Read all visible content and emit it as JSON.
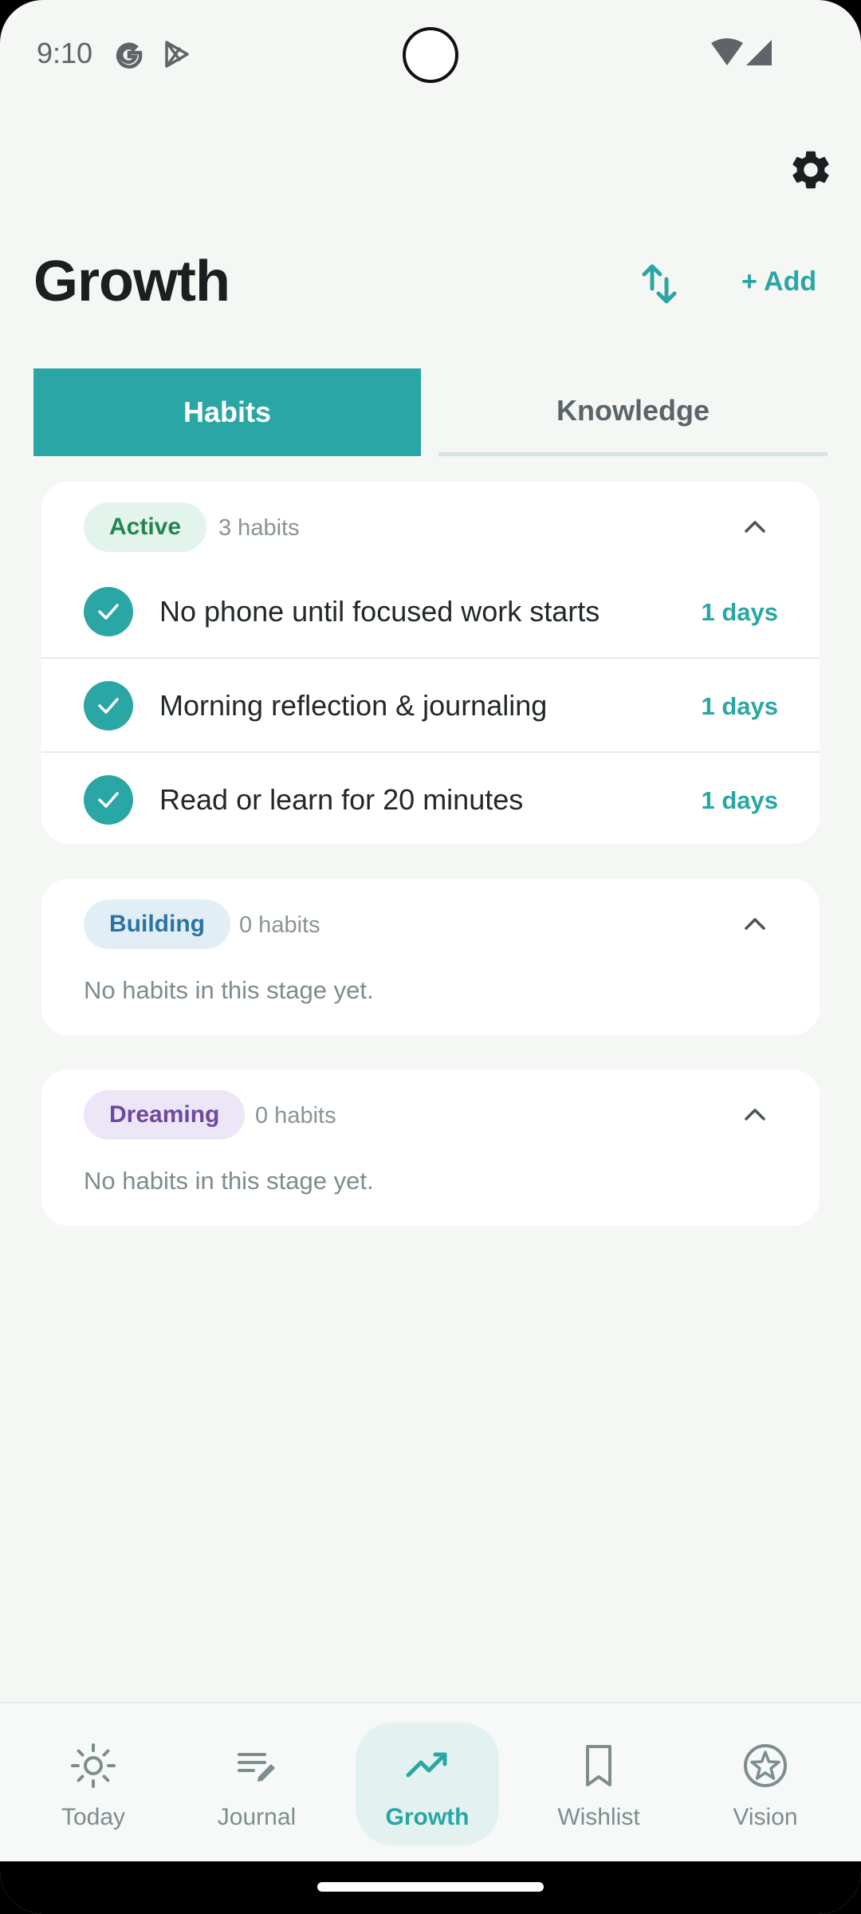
{
  "status_bar": {
    "time": "9:10"
  },
  "header": {
    "title": "Growth",
    "add_label": "+ Add"
  },
  "tabs": [
    {
      "label": "Habits",
      "selected": true
    },
    {
      "label": "Knowledge",
      "selected": false
    }
  ],
  "sections": {
    "active": {
      "badge": "Active",
      "count": "3 habits",
      "habits": [
        {
          "name": "No phone until focused work starts",
          "streak": "1 days"
        },
        {
          "name": "Morning reflection & journaling",
          "streak": "1 days"
        },
        {
          "name": "Read or learn for 20 minutes",
          "streak": "1 days"
        }
      ]
    },
    "building": {
      "badge": "Building",
      "count": "0 habits",
      "empty": "No habits in this stage yet."
    },
    "dreaming": {
      "badge": "Dreaming",
      "count": "0 habits",
      "empty": "No habits in this stage yet."
    }
  },
  "bottom_nav": [
    {
      "label": "Today",
      "icon": "sun-icon"
    },
    {
      "label": "Journal",
      "icon": "journal-edit-icon"
    },
    {
      "label": "Growth",
      "icon": "trending-up-icon",
      "selected": true
    },
    {
      "label": "Wishlist",
      "icon": "bookmark-icon"
    },
    {
      "label": "Vision",
      "icon": "star-circle-icon"
    }
  ],
  "colors": {
    "accent": "#2aa6a4",
    "active_badge": "#22864e",
    "building_badge": "#2a74a5",
    "dreaming_badge": "#6d4aa1",
    "background": "#f5f7f5"
  }
}
